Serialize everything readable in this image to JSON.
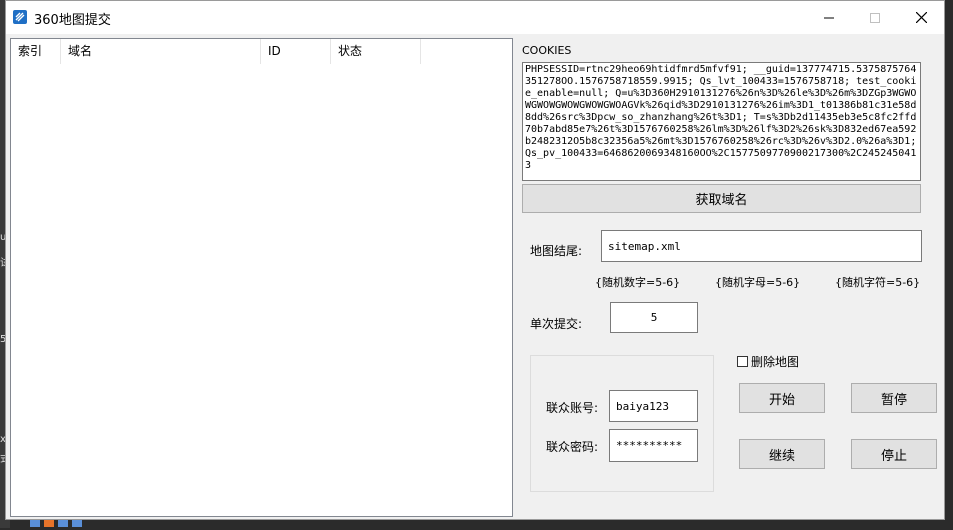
{
  "window": {
    "title": "360地图提交"
  },
  "table": {
    "columns": [
      "索引",
      "域名",
      "ID",
      "状态"
    ],
    "rows": []
  },
  "cookies": {
    "label": "COOKIES",
    "value": "PHPSESSID=rtnc29heo69htidfmrd5mfvf91; __guid=137774715.5375875764351278OO.1576758718559.9915; Qs_lvt_100433=1576758718; test_cookie_enable=null; Q=u%3D360H2910131276%26n%3D%26le%3D%26m%3DZGp3WGWOWGWOWGWOWGWOWGWOAGVk%26qid%3D2910131276%26im%3D1_t01386b81c31e58d8dd%26src%3Dpcw_so_zhanzhang%26t%3D1; T=s%3Db2d11435eb3e5c8fc2ffd70b7abd85e7%26t%3D1576760258%26lm%3D%26lf%3D2%26sk%3D832ed67ea592b2482312O5b8c32356a5%26mt%3D1576760258%26rc%3D%26v%3D2.0%26a%3D1; Qs_pv_100433=6468620069348160OO%2C1577509770900217300%2C2452450413"
  },
  "fetch_button": "获取域名",
  "sitemap": {
    "label": "地图结尾:",
    "value": "sitemap.xml"
  },
  "hints": [
    "{随机数字=5-6}",
    "{随机字母=5-6}",
    "{随机字符=5-6}"
  ],
  "batch": {
    "label": "单次提交:",
    "value": "5"
  },
  "account": {
    "username_label": "联众账号:",
    "username": "baiya123",
    "password_label": "联众密码:",
    "password": "**********"
  },
  "delete_map": {
    "label": "删除地图",
    "checked": false
  },
  "buttons": {
    "start": "开始",
    "pause": "暂停",
    "continue": "继续",
    "stop": "停止"
  }
}
